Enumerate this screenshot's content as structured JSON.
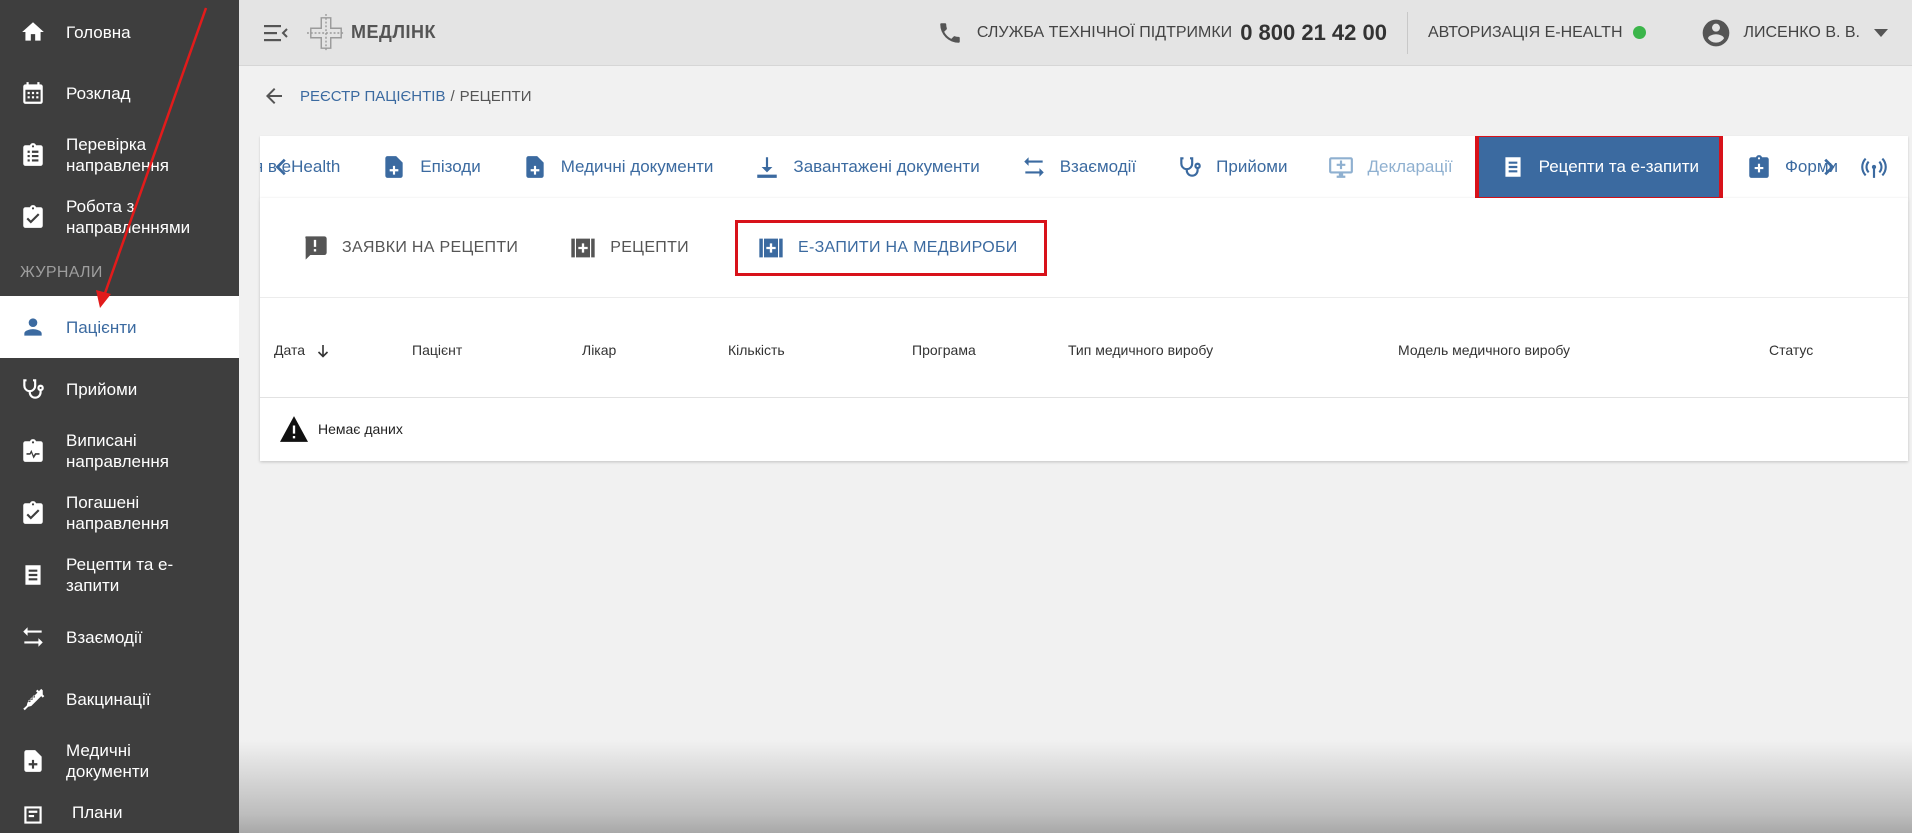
{
  "sidebar": {
    "items_top": [
      {
        "label": "Головна",
        "icon": "home-icon"
      },
      {
        "label": "Розклад",
        "icon": "calendar-icon"
      },
      {
        "label": "Перевірка направлення",
        "icon": "clipboard-list-icon"
      },
      {
        "label": "Робота з направленнями",
        "icon": "clipboard-check-icon"
      }
    ],
    "section_label": "ЖУРНАЛИ",
    "items_journal": [
      {
        "label": "Пацієнти",
        "icon": "person-icon",
        "active": true
      },
      {
        "label": "Прийоми",
        "icon": "stethoscope-icon"
      },
      {
        "label": "Виписані направлення",
        "icon": "clipboard-pulse-icon"
      },
      {
        "label": "Погашені направлення",
        "icon": "clipboard-check-icon"
      },
      {
        "label": "Рецепти та е-запити",
        "icon": "document-list-icon"
      },
      {
        "label": "Взаємодії",
        "icon": "swap-arrows-icon"
      },
      {
        "label": "Вакцинації",
        "icon": "syringe-icon"
      },
      {
        "label": "Медичні документи",
        "icon": "medical-file-icon"
      },
      {
        "label": "Плани",
        "icon": "plan-icon"
      }
    ]
  },
  "topbar": {
    "brand": "МЕДЛІНК",
    "support_label": "СЛУЖБА ТЕХНІЧНОЇ ПІДТРИМКИ",
    "support_phone": "0 800 21 42 00",
    "ehealth_label": "АВТОРИЗАЦІЯ E-HEALTH",
    "ehealth_status_color": "#3bb54a",
    "user_name": "ЛИСЕНКО В. В."
  },
  "breadcrumb": {
    "parent": "РЕЄСТР ПАЦІЄНТІВ",
    "separator": "/",
    "current": "РЕЦЕПТИ"
  },
  "tabs": [
    {
      "label": "я в eHealth",
      "icon": "none"
    },
    {
      "label": "Епізоди",
      "icon": "file-plus-icon"
    },
    {
      "label": "Медичні документи",
      "icon": "file-plus-icon"
    },
    {
      "label": "Завантажені документи",
      "icon": "download-icon"
    },
    {
      "label": "Взаємодії",
      "icon": "swap-arrows-icon"
    },
    {
      "label": "Прийоми",
      "icon": "stethoscope-icon"
    },
    {
      "label": "Декларації",
      "icon": "monitor-plus-icon",
      "disabled": true
    },
    {
      "label": "Рецепти та е-запити",
      "icon": "document-list-icon",
      "active": true
    },
    {
      "label": "Форми",
      "icon": "clipboard-plus-icon"
    }
  ],
  "subtabs": [
    {
      "label": "ЗАЯВКИ НА РЕЦЕПТИ",
      "icon": "exclamation-box-icon"
    },
    {
      "label": "РЕЦЕПТИ",
      "icon": "medkit-icon"
    },
    {
      "label": "Е-ЗАПИТИ НА МЕДВИРОБИ",
      "icon": "medkit-icon",
      "active": true
    }
  ],
  "table": {
    "columns": [
      "Дата",
      "Пацієнт",
      "Лікар",
      "Кількість",
      "Програма",
      "Тип медичного виробу",
      "Модель медичного виробу",
      "Статус"
    ],
    "empty_text": "Немає даних"
  },
  "colors": {
    "accent": "#3b6aa0",
    "highlight_red": "#d8121a",
    "sidebar_bg": "#3e3e3e"
  }
}
